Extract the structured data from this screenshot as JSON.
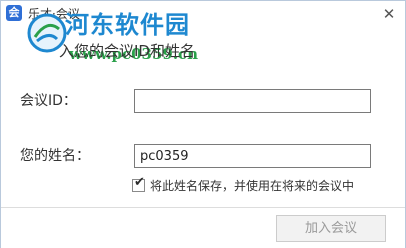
{
  "window": {
    "title": "乐才·会议",
    "close_icon": "close-icon",
    "app_icon_text": "会"
  },
  "watermark": {
    "brand": "河东软件园",
    "url": "www.pc0359.cn"
  },
  "dialog": {
    "subtitle": "入您的会议ID和姓名",
    "meeting_id_label": "会议ID：",
    "meeting_id_value": "",
    "name_label": "您的姓名：",
    "name_value": "pc0359",
    "remember_checked": true,
    "remember_label": "将此姓名保存，并使用在将来的会议中",
    "join_button_label": "加入会议",
    "join_button_enabled": false
  },
  "colors": {
    "accent": "#2f6fd6",
    "watermark_blue": "#1e88d0",
    "watermark_green": "#2aa04a",
    "disabled_text": "#9a9a9a"
  }
}
